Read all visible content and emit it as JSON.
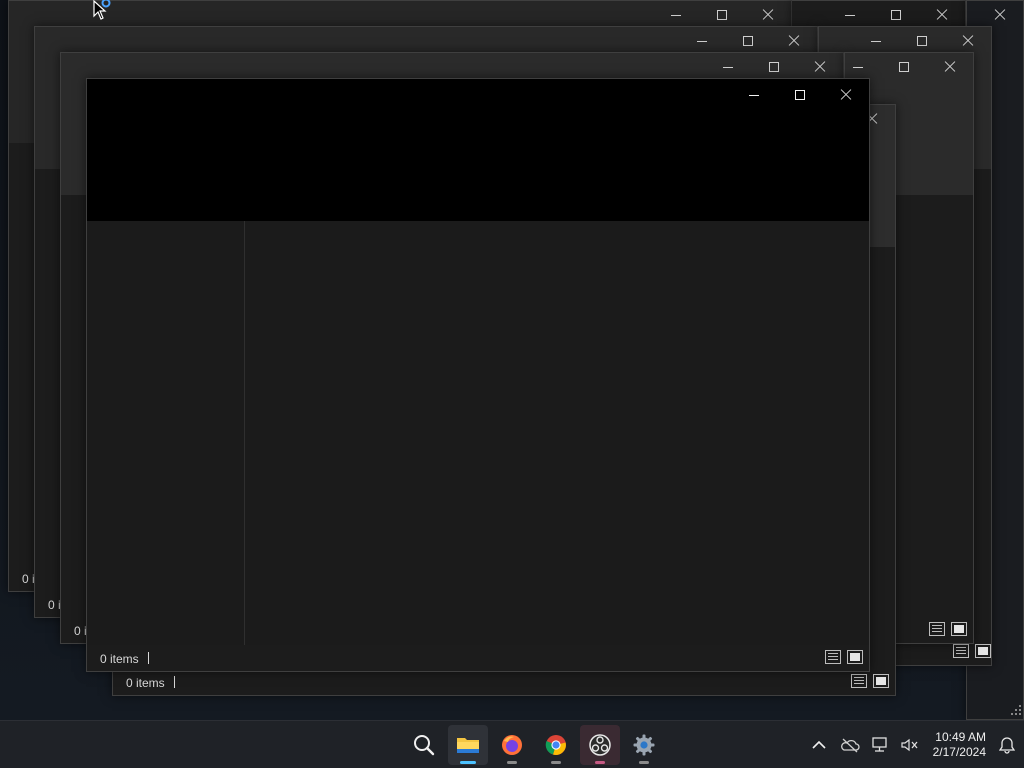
{
  "desktop": {
    "windows": [
      {
        "name": "explorer-window-5",
        "status": "0 i"
      },
      {
        "name": "explorer-window-4",
        "status": "0 i"
      },
      {
        "name": "explorer-window-3",
        "status": "0 i"
      },
      {
        "name": "explorer-window-2",
        "status": "0 items"
      },
      {
        "name": "explorer-window-front",
        "status": "0 items"
      }
    ]
  },
  "window_controls": {
    "minimize_icon": "minimize-icon",
    "maximize_icon": "maximize-icon",
    "close_icon": "close-icon"
  },
  "status_bar": {
    "item_count": "0 items",
    "details_view_icon": "details-view-icon",
    "tiles_view_icon": "large-icons-view-icon"
  },
  "taskbar": {
    "apps": [
      {
        "name": "search",
        "icon": "search-icon"
      },
      {
        "name": "file-explorer",
        "icon": "folder-icon",
        "state": "active"
      },
      {
        "name": "firefox",
        "icon": "firefox-icon",
        "state": "running"
      },
      {
        "name": "chrome",
        "icon": "chrome-icon",
        "state": "running"
      },
      {
        "name": "obs-studio",
        "icon": "obs-icon",
        "state": "running"
      },
      {
        "name": "settings",
        "icon": "gear-icon",
        "state": "running"
      }
    ],
    "tray": {
      "icons": [
        "chevron-up-icon",
        "onedrive-offline-icon",
        "network-icon",
        "volume-muted-icon"
      ],
      "time": "10:49 AM",
      "date": "2/17/2024",
      "notifications_icon": "bell-icon"
    }
  },
  "colors": {
    "window_bg": "#1c1c1c",
    "header_black": "#000000",
    "taskbar_bg": "#1f2227",
    "accent_blue": "#4cc2ff"
  }
}
